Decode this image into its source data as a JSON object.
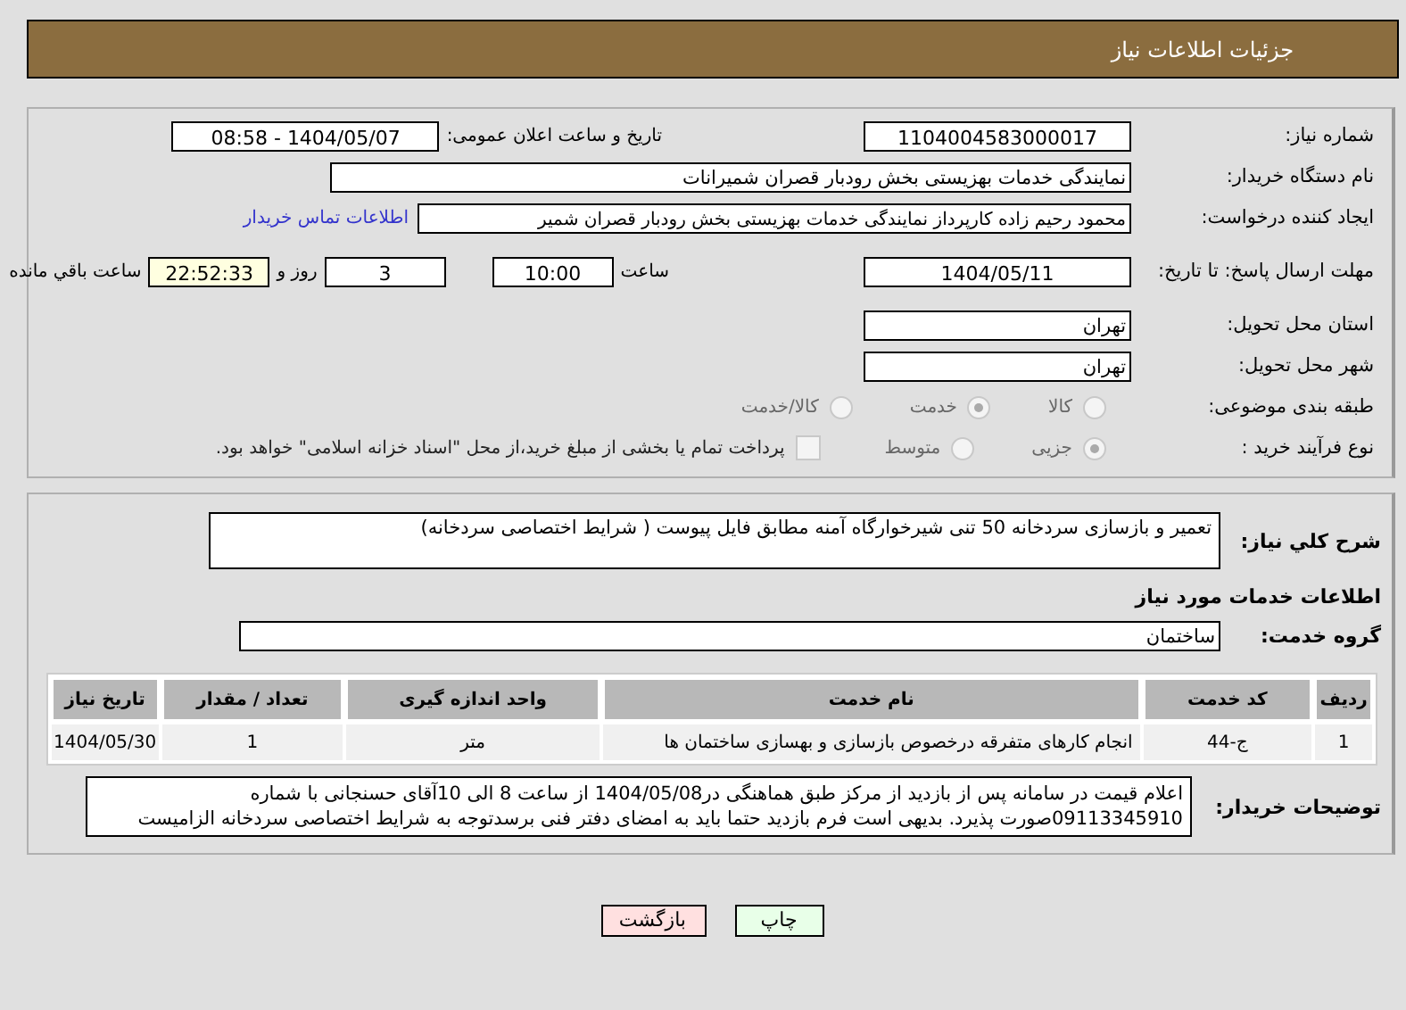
{
  "header": {
    "title": "جزئیات اطلاعات نیاز"
  },
  "details": {
    "need_number": {
      "label": "شماره نیاز:",
      "value": "1104004583000017"
    },
    "announce": {
      "label": "تاریخ و ساعت اعلان عمومی:",
      "value": "1404/05/07 - 08:58"
    },
    "buyer": {
      "label": "نام دستگاه خریدار:",
      "value": "نمایندگی خدمات بهزیستی بخش رودبار قصران   شمیرانات"
    },
    "creator": {
      "label": "ایجاد کننده درخواست:",
      "value": "محمود رحیم زاده کارپرداز نمایندگی خدمات بهزیستی بخش رودبار قصران   شمیر",
      "link": "اطلاعات تماس خریدار"
    },
    "deadline": {
      "label": "مهلت ارسال پاسخ: تا تاریخ:",
      "date": "1404/05/11",
      "time_label": "ساعت",
      "time": "10:00",
      "days": "3",
      "days_label": "روز و",
      "remaining": "22:52:33",
      "remaining_label": "ساعت باقي مانده"
    },
    "province": {
      "label": "استان محل تحویل:",
      "value": "تهران"
    },
    "city": {
      "label": "شهر محل تحویل:",
      "value": "تهران"
    },
    "category": {
      "label": "طبقه بندی موضوعی:",
      "options": [
        {
          "label": "کالا",
          "selected": false
        },
        {
          "label": "خدمت",
          "selected": true
        },
        {
          "label": "کالا/خدمت",
          "selected": false
        }
      ]
    },
    "process": {
      "label": "نوع فرآیند خرید :",
      "options": [
        {
          "label": "جزیی",
          "selected": true
        },
        {
          "label": "متوسط",
          "selected": false
        }
      ],
      "treasury": {
        "label": "پرداخت تمام یا بخشی از مبلغ خرید،از محل \"اسناد خزانه اسلامی\" خواهد بود.",
        "checked": false
      }
    }
  },
  "needs": {
    "description": {
      "label": "شرح کلي نیاز:",
      "value": "تعمیر و بازسازی سردخانه 50 تنی شیرخوارگاه آمنه مطابق فایل پیوست ( شرایط اختصاصی سردخانه)"
    },
    "section_title": "اطلاعات خدمات مورد نیاز",
    "service_group": {
      "label": "گروه خدمت:",
      "value": "ساختمان"
    },
    "table": {
      "columns": [
        "ردیف",
        "کد خدمت",
        "نام خدمت",
        "واحد اندازه گیری",
        "تعداد / مقدار",
        "تاریخ نیاز"
      ],
      "rows": [
        [
          "1",
          "ج-44",
          "انجام کارهای متفرقه درخصوص بازسازی و بهسازی ساختمان ها",
          "متر",
          "1",
          "1404/05/30"
        ]
      ]
    },
    "buyer_notes": {
      "label": "توضیحات خریدار:",
      "value": "اعلام قیمت در سامانه پس از بازدید از مرکز طبق هماهنگی در1404/05/08 از ساعت 8 الی 10آقای حسنجانی با شماره 09113345910صورت پذیرد. بدیهی است فرم بازدید حتما باید به امضای دفتر فنی برسدتوجه به شرایط اختصاصی سردخانه الزامیست"
    }
  },
  "buttons": [
    {
      "label": "چاپ",
      "kind": "print"
    },
    {
      "label": "بازگشت",
      "kind": "back"
    }
  ]
}
